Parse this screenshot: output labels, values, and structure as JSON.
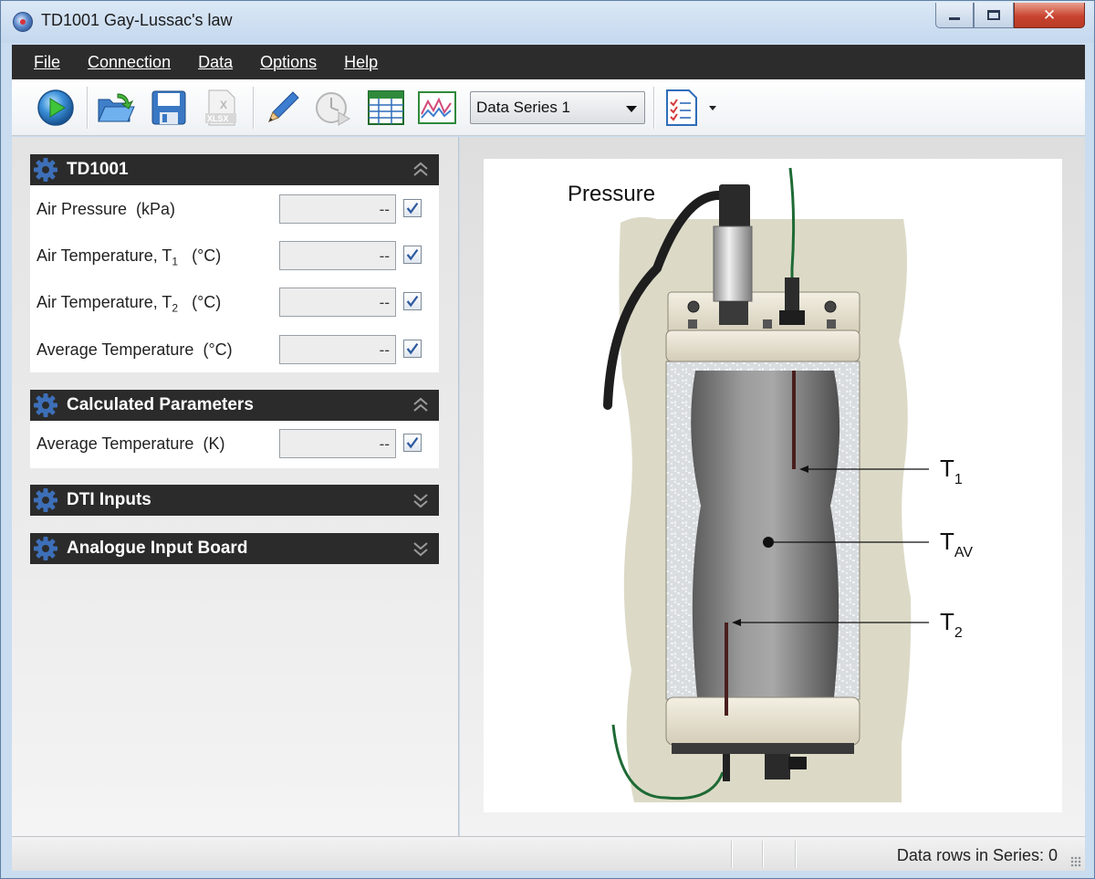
{
  "window": {
    "title": "TD1001 Gay-Lussac's law"
  },
  "menu": {
    "items": [
      "File",
      "Connection",
      "Data",
      "Options",
      "Help"
    ]
  },
  "toolbar": {
    "series_selected": "Data Series 1",
    "icons": [
      "play-icon",
      "open-folder-icon",
      "save-icon",
      "xlsx-export-icon",
      "pencil-icon",
      "timer-icon",
      "table-icon",
      "graph-icon",
      "report-icon"
    ],
    "xlsx_label": "XLSX"
  },
  "sections": [
    {
      "title": "TD1001",
      "expanded": true,
      "params": [
        {
          "label": "Air Pressure",
          "sub": "",
          "unit": "(kPa)",
          "value": "--",
          "checked": true
        },
        {
          "label": "Air Temperature, T",
          "sub": "1",
          "unit": "(°C)",
          "value": "--",
          "checked": true
        },
        {
          "label": "Air Temperature, T",
          "sub": "2",
          "unit": "(°C)",
          "value": "--",
          "checked": true
        },
        {
          "label": "Average Temperature",
          "sub": "",
          "unit": "(°C)",
          "value": "--",
          "checked": true
        }
      ]
    },
    {
      "title": "Calculated Parameters",
      "expanded": true,
      "params": [
        {
          "label": "Average Temperature",
          "sub": "",
          "unit": "(K)",
          "value": "--",
          "checked": true
        }
      ]
    },
    {
      "title": "DTI Inputs",
      "expanded": false
    },
    {
      "title": "Analogue Input Board",
      "expanded": false
    }
  ],
  "diagram": {
    "pressure_label": "Pressure",
    "t1_main": "T",
    "t1_sub": "1",
    "tav_main": "T",
    "tav_sub": "AV",
    "t2_main": "T",
    "t2_sub": "2"
  },
  "status": {
    "data_rows": "Data rows in Series: 0"
  },
  "colors": {
    "menubar": "#2c2c2c",
    "section_header": "#2b2b2b",
    "gear": "#3d6fb8",
    "close_button": "#c8442f"
  }
}
